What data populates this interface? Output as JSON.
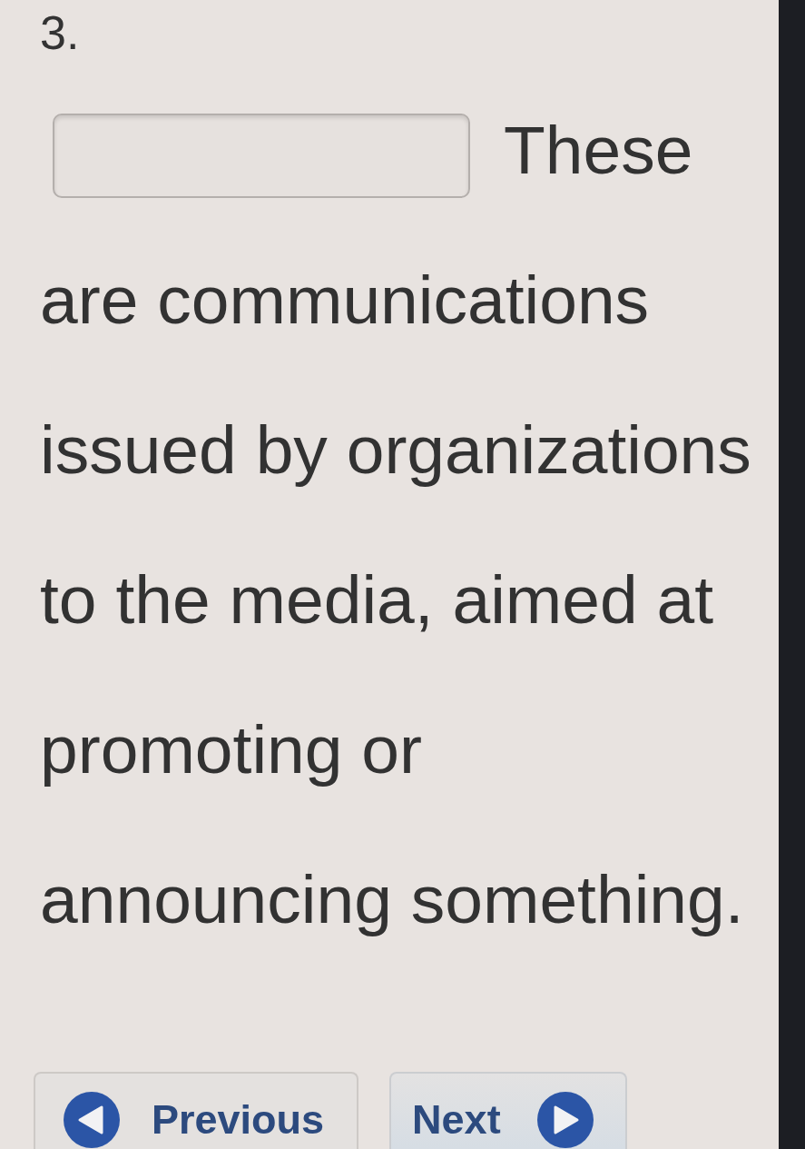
{
  "question": {
    "number": "3.",
    "parts": [
      {
        "kind": "blank"
      },
      {
        "kind": "text",
        "text": "These"
      },
      {
        "kind": "paragraph",
        "text": "are communications issued by organizations to the media, aimed at promoting or announcing something."
      }
    ]
  },
  "buttons": [
    {
      "kind": "previous",
      "label": "Previous"
    },
    {
      "kind": "next",
      "label": "Next"
    }
  ]
}
